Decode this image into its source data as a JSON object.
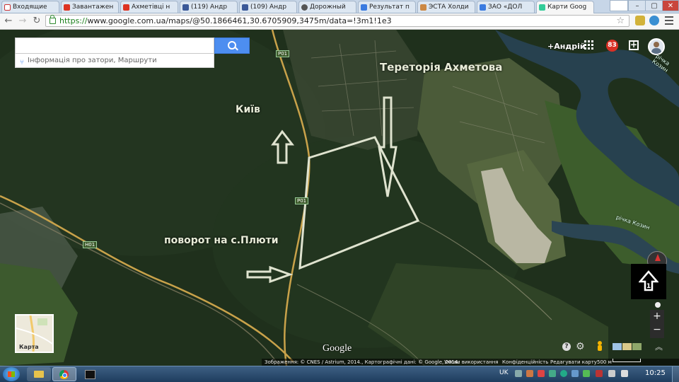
{
  "browser": {
    "tabs": [
      {
        "label": "Входящие",
        "icon": "gmail-icon"
      },
      {
        "label": "Завантажен",
        "icon": "youtube-icon"
      },
      {
        "label": "Ахметівці н",
        "icon": "youtube-icon"
      },
      {
        "label": "(119) Андр",
        "icon": "facebook-icon"
      },
      {
        "label": "(109) Андр",
        "icon": "facebook-icon"
      },
      {
        "label": "Дорожный",
        "icon": "github-icon"
      },
      {
        "label": "Результат п",
        "icon": "google-icon"
      },
      {
        "label": "ЭСТА Холди",
        "icon": "esta-icon"
      },
      {
        "label": "ЗАО «ДОЛ",
        "icon": "google-icon"
      },
      {
        "label": "Карти Goog",
        "icon": "google-maps-icon",
        "active": true
      }
    ],
    "url_secure": "https://",
    "url_rest": "www.google.com.ua/maps/@50.1866461,30.6705909,3475m/data=!3m1!1e3",
    "win_minimize": "–",
    "win_maximize": "▢",
    "win_close": "✕"
  },
  "maps": {
    "search_placeholder": "",
    "traffic_link": "Інформація про затори, Маршрути",
    "user_name": "+Андрій",
    "notifications": "83",
    "google_logo": "Google",
    "minimap_label": "Карта",
    "footer": {
      "imagery": "Зображення: © CNES / Astrium, 2014., Картографічні дані: © Google, 2014.",
      "terms": "Умови використання",
      "privacy": "Конфіденційність",
      "report": "Редагувати карту",
      "scale": "500 м"
    },
    "zoom_in": "+",
    "zoom_out": "−",
    "help": "?"
  },
  "map_labels": {
    "akhmetov_territory": "Терeторія Ахметова",
    "kyiv": "Київ",
    "turn_pliuty": "поворот на с.Плюти",
    "road_p01": "P01",
    "road_h01": "H01",
    "river": "річка Козин"
  },
  "taskbar": {
    "language": "UK",
    "clock": "10:25"
  },
  "colors": {
    "search_button": "#4d8ef0",
    "annotation": "#e8ecd8",
    "road": "#c9a24a",
    "forest": "#22331f",
    "river": "#27414f"
  }
}
